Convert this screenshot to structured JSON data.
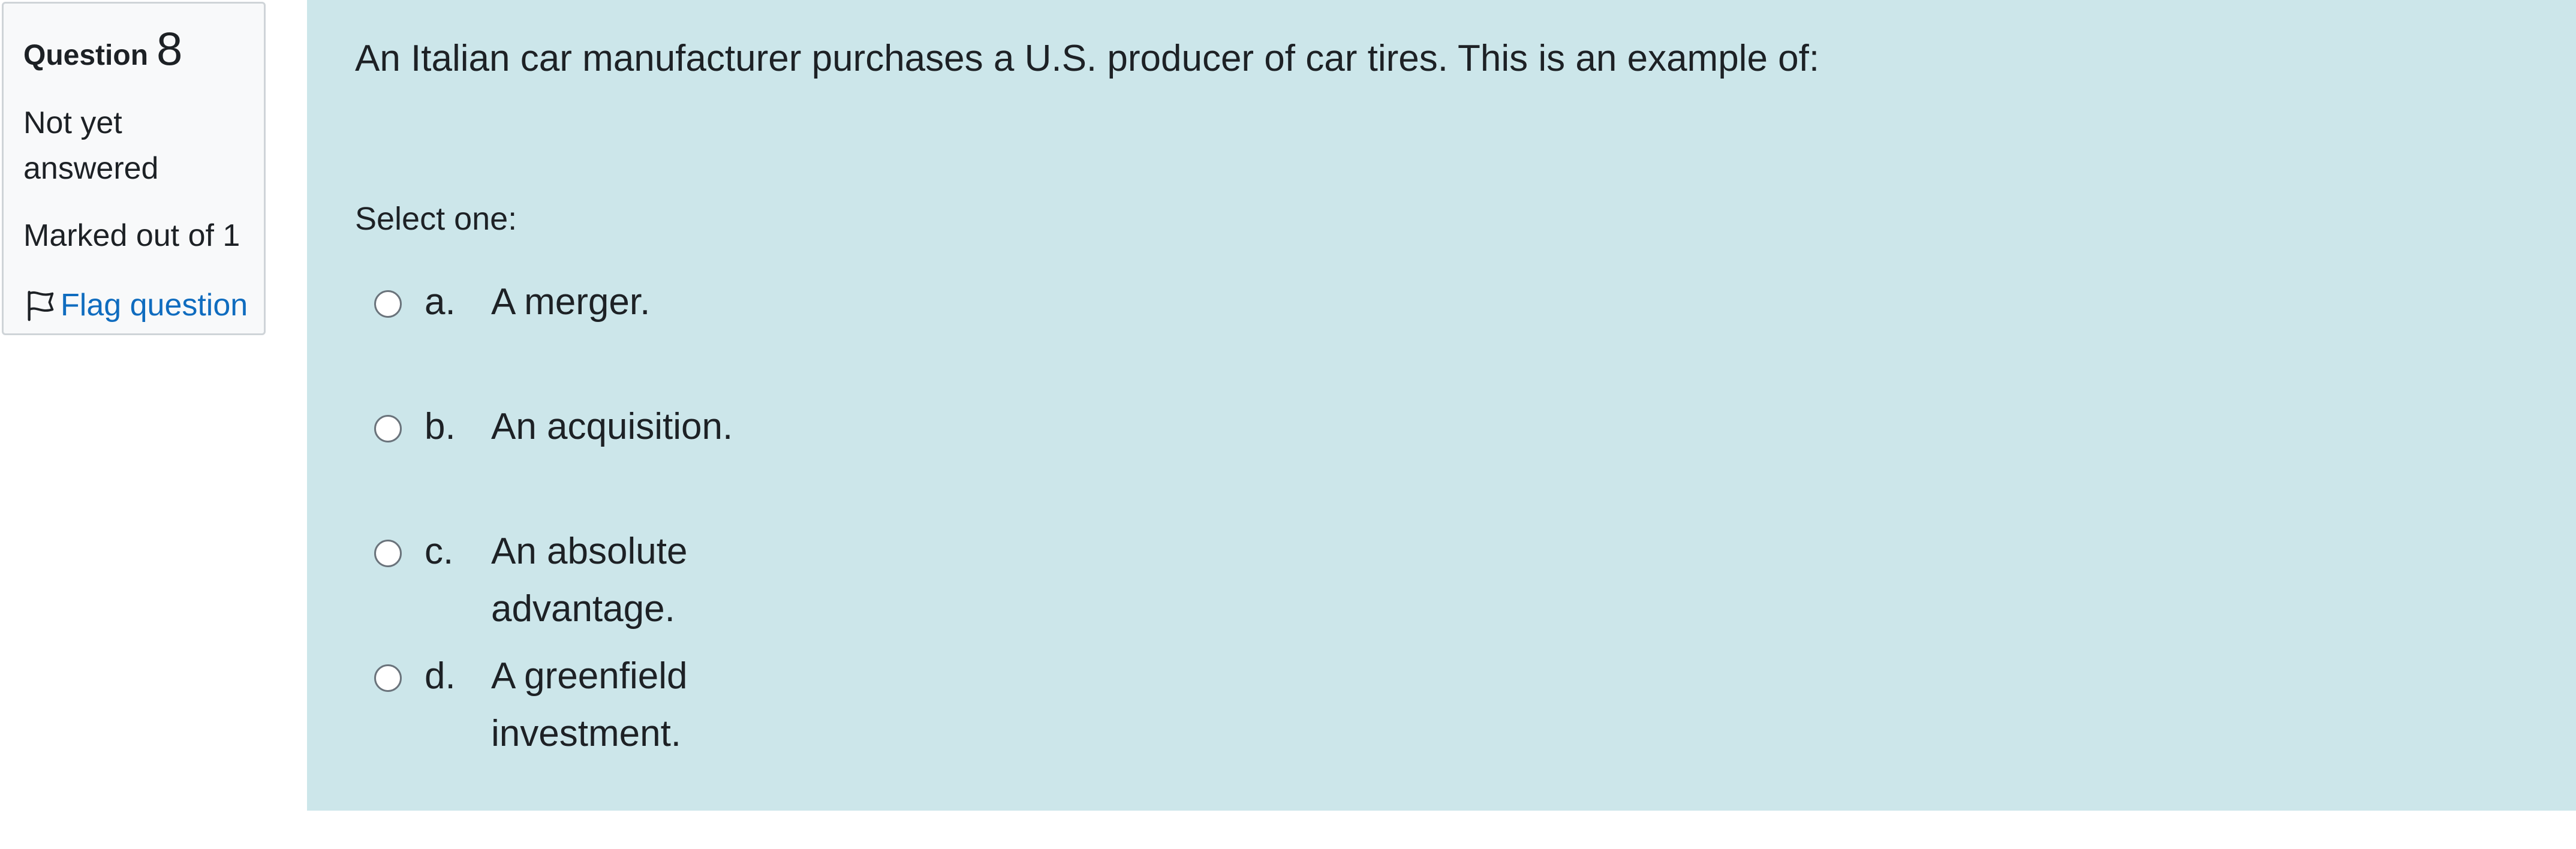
{
  "info": {
    "question_word": "Question",
    "question_number": "8",
    "state": "Not yet answered",
    "grade": "Marked out of 1",
    "flag_label": "Flag question"
  },
  "question": {
    "text": "An Italian car manufacturer purchases a U.S. producer of car tires. This is an example of:",
    "prompt": "Select one:"
  },
  "answers": [
    {
      "letter": "a.",
      "text": "A merger.",
      "selected": false
    },
    {
      "letter": "b.",
      "text": "An acquisition.",
      "selected": false
    },
    {
      "letter": "c.",
      "text": "An absolute advantage.",
      "selected": false
    },
    {
      "letter": "d.",
      "text": "A greenfield investment.",
      "selected": false
    }
  ],
  "colors": {
    "content_background": "#cce6ea",
    "info_background": "#f8f9fa",
    "link": "#0f6cbf"
  },
  "icons": {
    "flag": "flag-outline-icon",
    "radio": "radio-unchecked-icon"
  }
}
